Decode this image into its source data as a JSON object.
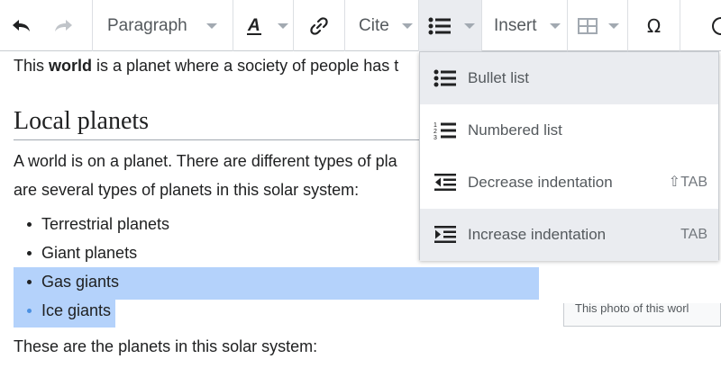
{
  "toolbar": {
    "paragraph_label": "Paragraph",
    "cite_label": "Cite",
    "insert_label": "Insert",
    "special_char_glyph": "Ω"
  },
  "content": {
    "p1": {
      "before": "This ",
      "bold": "world",
      "after": " is a planet where a society of people has t"
    },
    "heading": "Local planets",
    "p2_line1": "A world is on a planet.  There are different types of pla",
    "p2_line2": "are several types of planets in this solar system:",
    "list": [
      "Terrestrial planets",
      "Giant planets",
      "Gas giants",
      "Ice giants"
    ],
    "p3": "These are the planets in this solar system:",
    "photo_caption": "This photo of this worl"
  },
  "menu": {
    "items": [
      {
        "label": "Bullet list",
        "shortcut": ""
      },
      {
        "label": "Numbered list",
        "shortcut": ""
      },
      {
        "label": "Decrease indentation",
        "shortcut": "⇧TAB"
      },
      {
        "label": "Increase indentation",
        "shortcut": "TAB"
      }
    ]
  },
  "colors": {
    "selection": "#b4d2fb",
    "menu_highlight": "#eaecf0",
    "list_bullet": "#202122"
  }
}
